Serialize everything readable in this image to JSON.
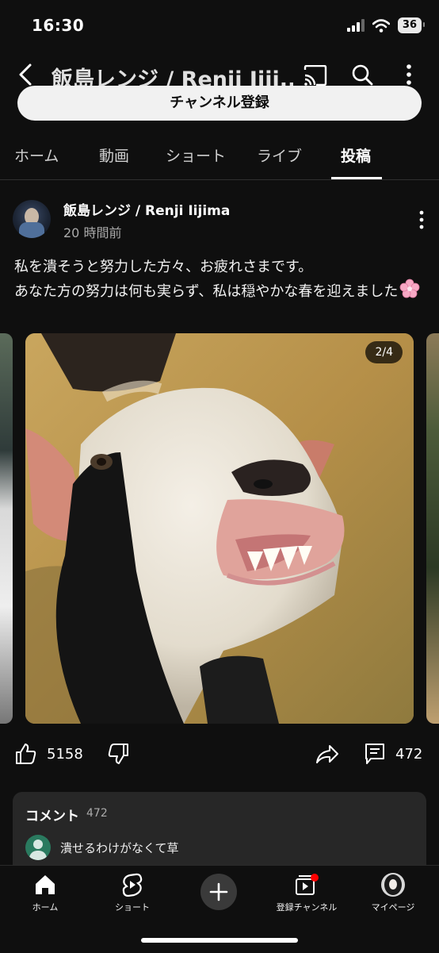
{
  "status_bar": {
    "time": "16:30",
    "battery": "36"
  },
  "header": {
    "channel_title": "飯島レンジ / Renji Iiji..."
  },
  "subscribe_button": {
    "label": "チャンネル登録"
  },
  "tabs": [
    {
      "label": "ホーム"
    },
    {
      "label": "動画"
    },
    {
      "label": "ショート"
    },
    {
      "label": "ライブ"
    },
    {
      "label": "投稿",
      "active": true
    }
  ],
  "post": {
    "author": "飯島レンジ / Renji Iijima",
    "posted_ago": "20 時間前",
    "text_line1": "私を潰そうと努力した方々、お疲れさまです。",
    "text_line2": "あなた方の努力は何も実らず、私は穏やかな春を迎えました",
    "image_counter": "2/4",
    "like_count": "5158",
    "comment_count": "472"
  },
  "comments_panel": {
    "label": "コメント",
    "count": "472",
    "top_comment": "潰せるわけがなくて草"
  },
  "bottom_nav": [
    {
      "label": "ホーム",
      "icon": "home-icon"
    },
    {
      "label": "ショート",
      "icon": "shorts-icon"
    },
    {
      "label": "",
      "icon": "plus-icon"
    },
    {
      "label": "登録チャンネル",
      "icon": "subscriptions-icon"
    },
    {
      "label": "マイページ",
      "icon": "avatar"
    }
  ],
  "colors": {
    "background": "#0f0f0f",
    "notification_dot": "#ff0000"
  }
}
